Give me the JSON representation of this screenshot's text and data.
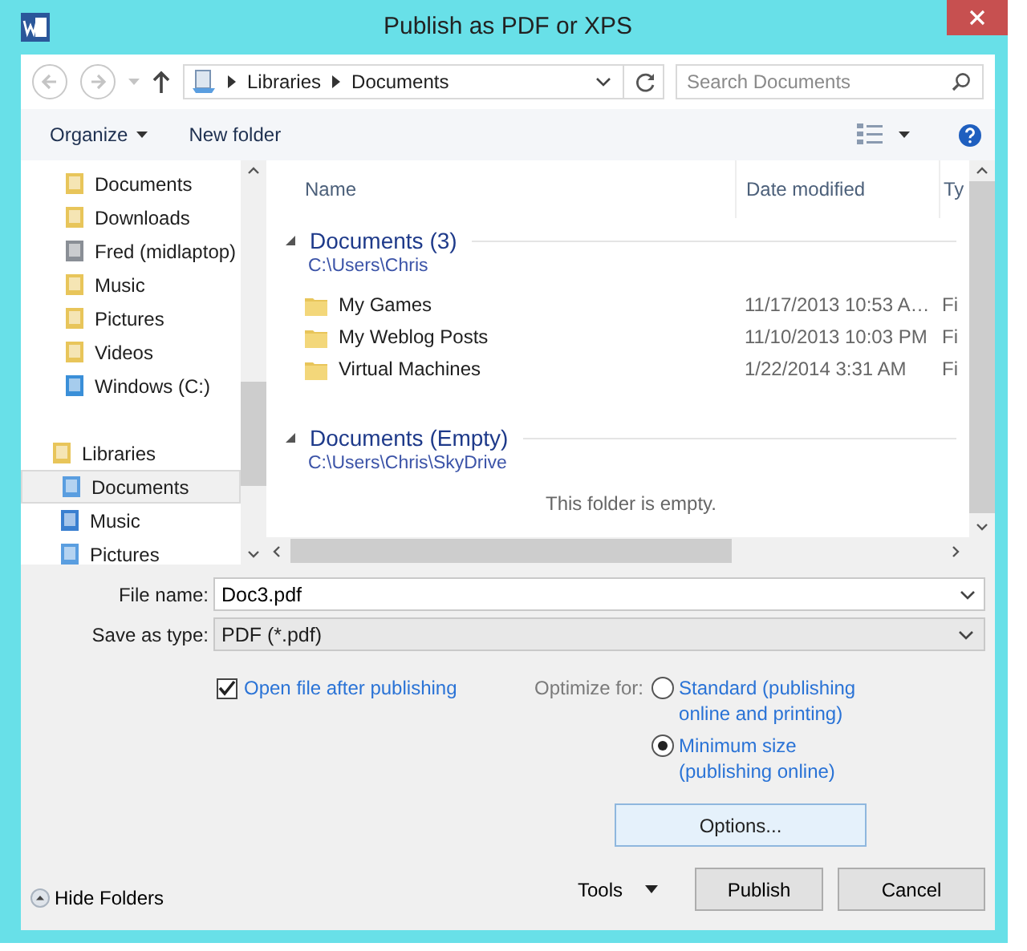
{
  "window": {
    "title": "Publish as PDF or XPS"
  },
  "address": {
    "crumbs": [
      "Libraries",
      "Documents"
    ]
  },
  "search": {
    "placeholder": "Search Documents"
  },
  "toolbar": {
    "organize": "Organize",
    "new_folder": "New folder"
  },
  "sidebar": {
    "items": [
      {
        "label": "Documents",
        "kind": "docs",
        "selected": false
      },
      {
        "label": "Downloads",
        "kind": "downloads",
        "selected": false
      },
      {
        "label": "Fred (midlaptop)",
        "kind": "computer",
        "selected": false
      },
      {
        "label": "Music",
        "kind": "music",
        "selected": false
      },
      {
        "label": "Pictures",
        "kind": "pictures",
        "selected": false
      },
      {
        "label": "Videos",
        "kind": "videos",
        "selected": false
      },
      {
        "label": "Windows (C:)",
        "kind": "drive",
        "selected": false
      },
      {
        "label": "Libraries",
        "kind": "library",
        "selected": false,
        "children": [
          {
            "label": "Documents",
            "kind": "lib-docs",
            "selected": true
          },
          {
            "label": "Music",
            "kind": "lib-music",
            "selected": false
          },
          {
            "label": "Pictures",
            "kind": "lib-pictures",
            "selected": false
          }
        ]
      }
    ]
  },
  "content": {
    "columns": [
      "Name",
      "Date modified",
      "Ty"
    ],
    "groups": [
      {
        "title": "Documents (3)",
        "path": "C:\\Users\\Chris",
        "rows": [
          {
            "name": "My Games",
            "date": "11/17/2013 10:53 A…",
            "type": "Fi"
          },
          {
            "name": "My Weblog Posts",
            "date": "11/10/2013 10:03 PM",
            "type": "Fi"
          },
          {
            "name": "Virtual Machines",
            "date": "1/22/2014 3:31 AM",
            "type": "Fi"
          }
        ]
      },
      {
        "title": "Documents (Empty)",
        "path": "C:\\Users\\Chris\\SkyDrive",
        "empty_text": "This folder is empty."
      }
    ]
  },
  "file_name": {
    "label": "File name:",
    "value": "Doc3.pdf"
  },
  "save_type": {
    "label": "Save as type:",
    "value": "PDF (*.pdf)"
  },
  "open_after": {
    "label": "Open file after publishing",
    "checked": true
  },
  "optimize": {
    "label": "Optimize for:",
    "options": [
      {
        "label": "Standard (publishing online and printing)",
        "selected": false
      },
      {
        "label": "Minimum size (publishing online)",
        "selected": true
      }
    ]
  },
  "options_button": "Options...",
  "hide_folders": "Hide Folders",
  "tools": "Tools",
  "buttons": [
    "Publish",
    "Cancel"
  ]
}
